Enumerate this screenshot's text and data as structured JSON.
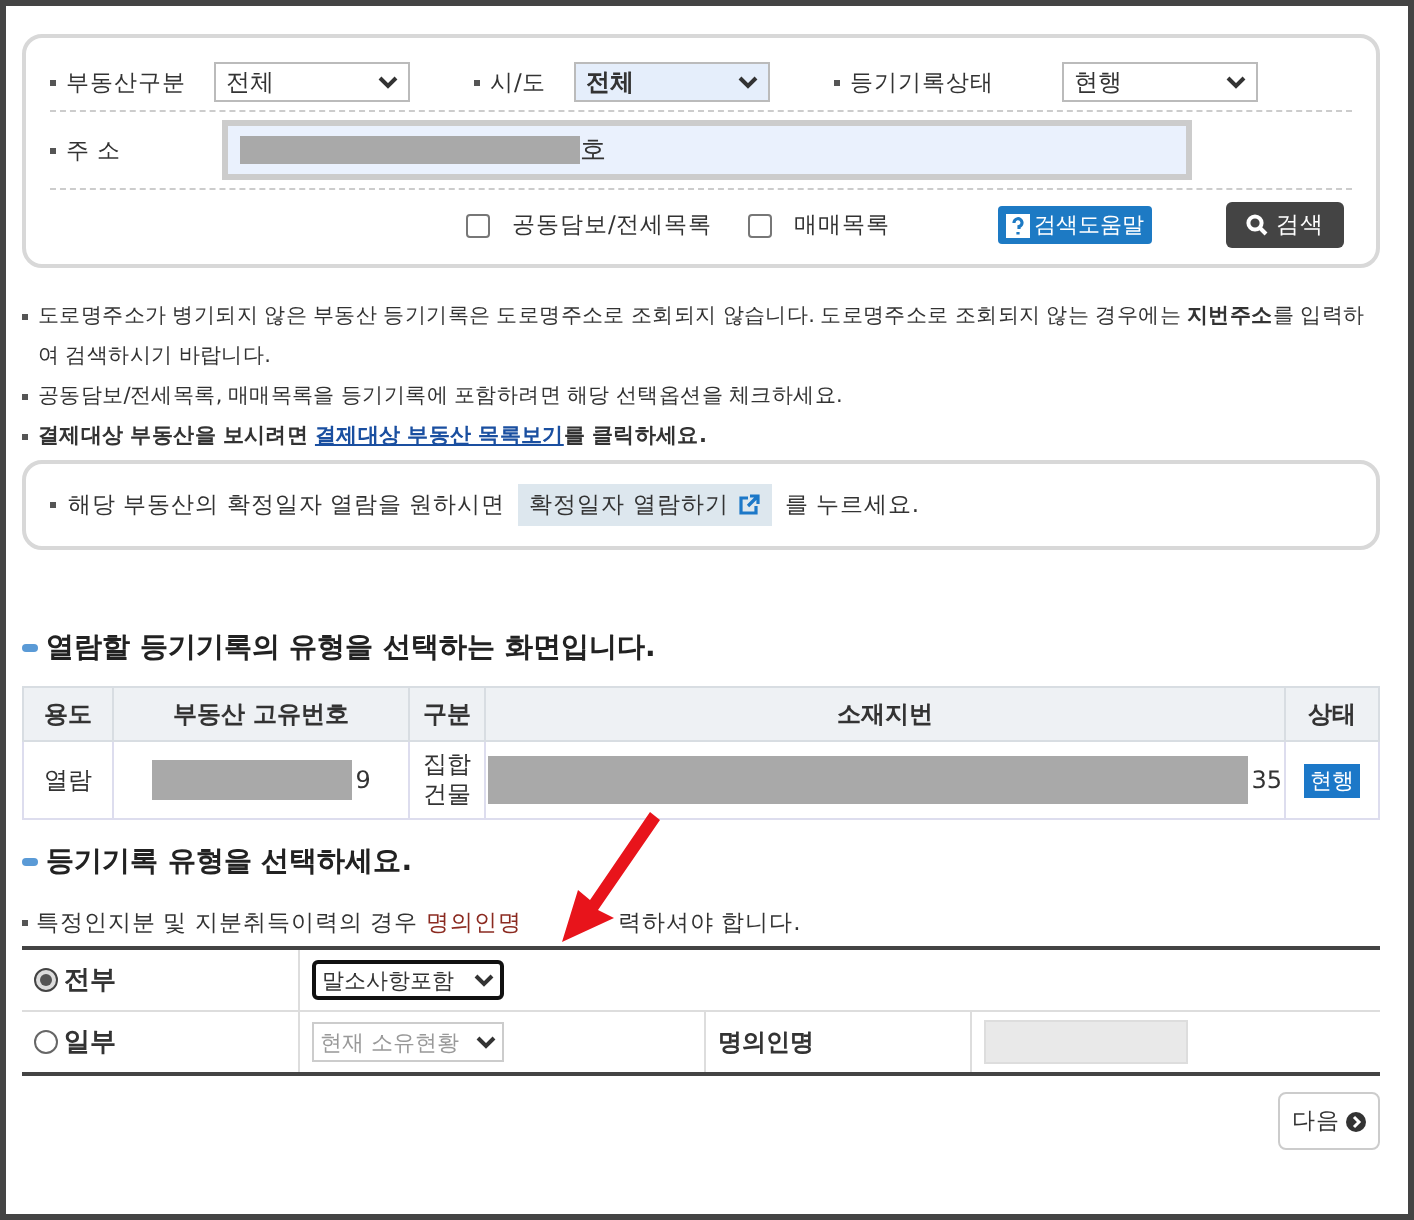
{
  "search": {
    "fields": [
      {
        "label": "부동산구분",
        "value": "전체",
        "highlighted": false
      },
      {
        "label": "시/도",
        "value": "전체",
        "highlighted": true
      },
      {
        "label": "등기기록상태",
        "value": "현행",
        "highlighted": false
      }
    ],
    "address": {
      "label": "주 소",
      "value": "호"
    },
    "options": [
      {
        "label": "공동담보/전세목록",
        "checked": false
      },
      {
        "label": "매매목록",
        "checked": false
      }
    ],
    "help_button": "검색도움말",
    "search_button": "검색"
  },
  "notes": [
    {
      "text": "도로명주소가 병기되지 않은 부동산 등기기록은 도로명주소로 조회되지 않습니다. 도로명주소로 조회되지 않는 경우에는 **지번주소**를 입력하여 검색하시기 바랍니다.",
      "bold": false
    },
    {
      "text": "공동담보/전세목록, 매매목록을 등기기록에 포함하려면 해당 선택옵션을 체크하세요.",
      "bold": false
    },
    {
      "text": "결제대상 부동산을 보시려면 ",
      "link": "결제대상 부동산 목록보기",
      "after": "를 클릭하세요.",
      "bold": true
    }
  ],
  "confirm_box": {
    "before": "해당 부동산의 확정일자 열람을 원하시면",
    "button": "확정일자 열람하기",
    "after": "를 누르세요."
  },
  "section1": {
    "title": "열람할 등기기록의 유형을 선택하는 화면입니다.",
    "table": {
      "columns": [
        "용도",
        "부동산 고유번호",
        "구분",
        "소재지번",
        "상태"
      ],
      "rows": [
        {
          "usage": "열람",
          "number": "9",
          "type": "집합건물",
          "location": "35",
          "status": "현행"
        }
      ]
    }
  },
  "section2": {
    "title": "등기기록 유형을 선택하세요.",
    "note_before": "특정인지분 및 지분취득이력의 경우",
    "note_highlight": "명의인명",
    "note_after": "력하셔야 합니다.",
    "rows": [
      {
        "label": "전부",
        "selected": true,
        "select": "말소사항포함",
        "disabled": false
      },
      {
        "label": "일부",
        "selected": false,
        "select": "현재 소유현황",
        "disabled": true,
        "name_label": "명의인명"
      }
    ]
  },
  "next_button": "다음"
}
